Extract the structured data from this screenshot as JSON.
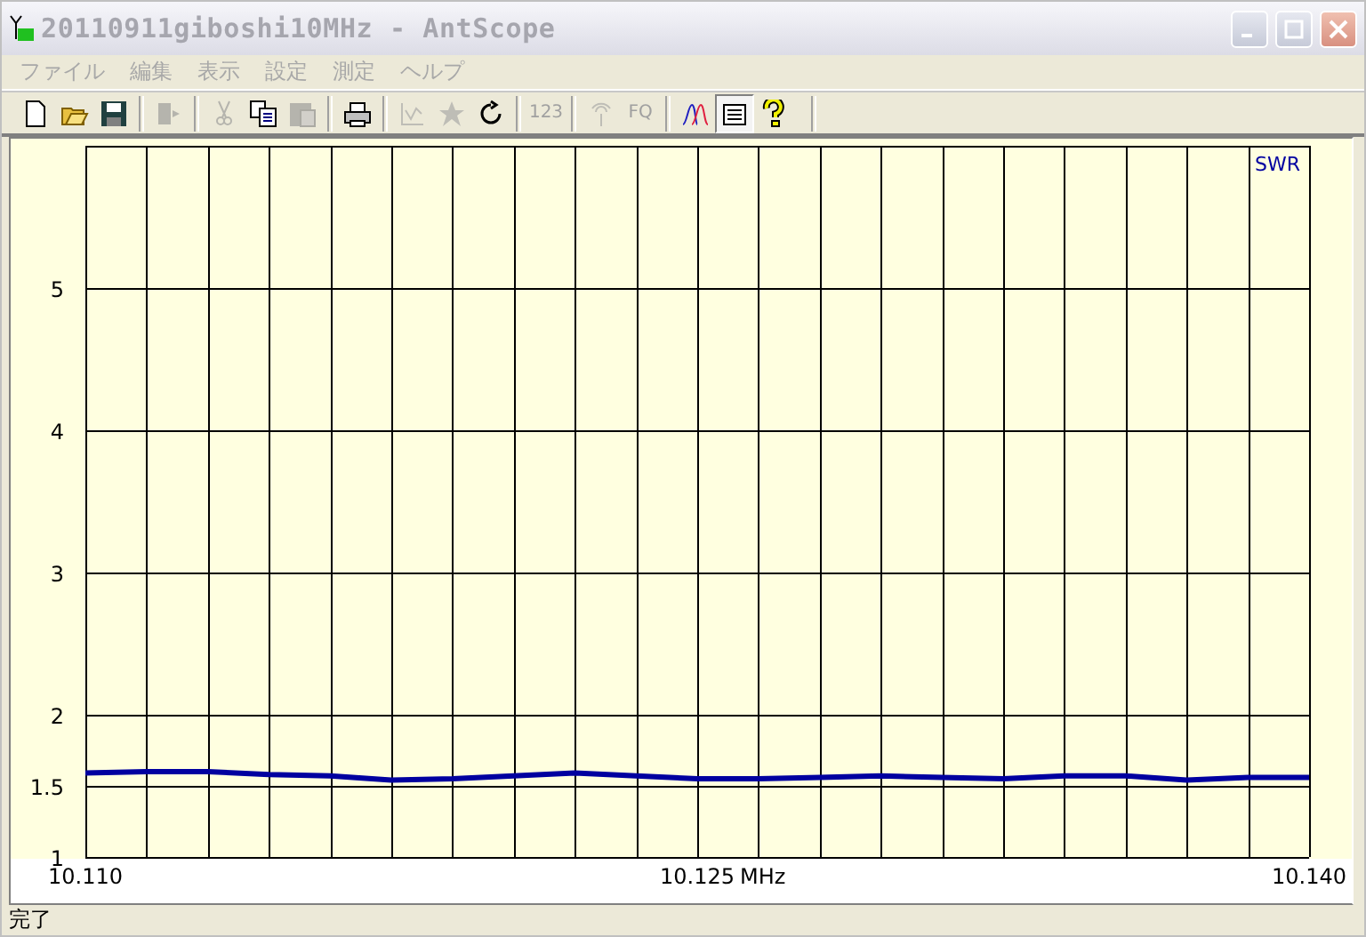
{
  "window": {
    "title": "20110911giboshi10MHz - AntScope"
  },
  "menu": [
    "ファイル",
    "編集",
    "表示",
    "設定",
    "測定",
    "ヘルプ"
  ],
  "toolbar": [
    {
      "kind": "icon",
      "disabled": false,
      "pressed": false
    },
    {
      "kind": "icon",
      "disabled": false,
      "pressed": false
    },
    {
      "kind": "icon",
      "disabled": false,
      "pressed": false
    },
    {
      "kind": "separator"
    },
    {
      "kind": "icon",
      "disabled": true,
      "pressed": false
    },
    {
      "kind": "separator"
    },
    {
      "kind": "icon",
      "disabled": true,
      "pressed": false
    },
    {
      "kind": "icon",
      "disabled": false,
      "pressed": false
    },
    {
      "kind": "icon",
      "disabled": true,
      "pressed": false
    },
    {
      "kind": "separator"
    },
    {
      "kind": "icon",
      "disabled": false,
      "pressed": false
    },
    {
      "kind": "separator"
    },
    {
      "kind": "icon",
      "disabled": true,
      "pressed": false
    },
    {
      "kind": "icon",
      "disabled": true,
      "pressed": false
    },
    {
      "kind": "icon",
      "disabled": false,
      "pressed": false
    },
    {
      "kind": "separator"
    },
    {
      "kind": "text",
      "label": "123",
      "disabled": true,
      "pressed": false
    },
    {
      "kind": "separator"
    },
    {
      "kind": "icon",
      "disabled": true,
      "pressed": false
    },
    {
      "kind": "text",
      "label": "FQ",
      "disabled": true,
      "pressed": false
    },
    {
      "kind": "separator"
    },
    {
      "kind": "icon",
      "disabled": false,
      "pressed": false
    },
    {
      "kind": "icon",
      "disabled": false,
      "pressed": true
    },
    {
      "kind": "icon",
      "disabled": false,
      "pressed": false
    },
    {
      "kind": "separator"
    }
  ],
  "chart": {
    "chart_data": {
      "type": "line",
      "grid": true,
      "xlabel": "MHz",
      "xlim": [
        10.11,
        10.14
      ],
      "ylim": [
        1,
        6
      ],
      "xticks": [
        {
          "value": 10.11,
          "label": "10.110"
        },
        {
          "value": 10.125,
          "label": "10.125"
        },
        {
          "value": 10.14,
          "label": "10.140"
        }
      ],
      "yticks": [
        {
          "value": 1,
          "label": "1"
        },
        {
          "value": 1.5,
          "label": "1.5"
        },
        {
          "value": 2,
          "label": "2"
        },
        {
          "value": 3,
          "label": "3"
        },
        {
          "value": 4,
          "label": "4"
        },
        {
          "value": 5,
          "label": "5"
        }
      ],
      "x": [
        10.11,
        10.1115,
        10.113,
        10.1145,
        10.116,
        10.1175,
        10.119,
        10.1205,
        10.122,
        10.1235,
        10.125,
        10.1265,
        10.128,
        10.1295,
        10.131,
        10.1325,
        10.134,
        10.1355,
        10.137,
        10.1385,
        10.14
      ],
      "series": [
        {
          "name": "SWR",
          "color": "#0000a0",
          "values": [
            1.59,
            1.6,
            1.6,
            1.58,
            1.57,
            1.54,
            1.55,
            1.57,
            1.59,
            1.57,
            1.55,
            1.55,
            1.56,
            1.57,
            1.56,
            1.55,
            1.57,
            1.57,
            1.54,
            1.56,
            1.56
          ]
        }
      ]
    }
  },
  "status_bar": {
    "text": "完了"
  }
}
